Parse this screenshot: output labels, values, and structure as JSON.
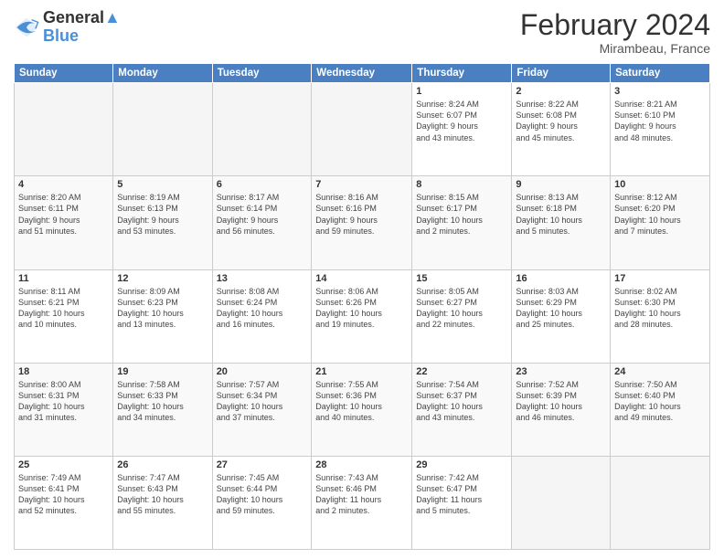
{
  "header": {
    "logo_line1": "General",
    "logo_line2": "Blue",
    "title": "February 2024",
    "subtitle": "Mirambeau, France"
  },
  "days_of_week": [
    "Sunday",
    "Monday",
    "Tuesday",
    "Wednesday",
    "Thursday",
    "Friday",
    "Saturday"
  ],
  "weeks": [
    [
      {
        "num": "",
        "info": "",
        "empty": true
      },
      {
        "num": "",
        "info": "",
        "empty": true
      },
      {
        "num": "",
        "info": "",
        "empty": true
      },
      {
        "num": "",
        "info": "",
        "empty": true
      },
      {
        "num": "1",
        "info": "Sunrise: 8:24 AM\nSunset: 6:07 PM\nDaylight: 9 hours\nand 43 minutes."
      },
      {
        "num": "2",
        "info": "Sunrise: 8:22 AM\nSunset: 6:08 PM\nDaylight: 9 hours\nand 45 minutes."
      },
      {
        "num": "3",
        "info": "Sunrise: 8:21 AM\nSunset: 6:10 PM\nDaylight: 9 hours\nand 48 minutes."
      }
    ],
    [
      {
        "num": "4",
        "info": "Sunrise: 8:20 AM\nSunset: 6:11 PM\nDaylight: 9 hours\nand 51 minutes."
      },
      {
        "num": "5",
        "info": "Sunrise: 8:19 AM\nSunset: 6:13 PM\nDaylight: 9 hours\nand 53 minutes."
      },
      {
        "num": "6",
        "info": "Sunrise: 8:17 AM\nSunset: 6:14 PM\nDaylight: 9 hours\nand 56 minutes."
      },
      {
        "num": "7",
        "info": "Sunrise: 8:16 AM\nSunset: 6:16 PM\nDaylight: 9 hours\nand 59 minutes."
      },
      {
        "num": "8",
        "info": "Sunrise: 8:15 AM\nSunset: 6:17 PM\nDaylight: 10 hours\nand 2 minutes."
      },
      {
        "num": "9",
        "info": "Sunrise: 8:13 AM\nSunset: 6:18 PM\nDaylight: 10 hours\nand 5 minutes."
      },
      {
        "num": "10",
        "info": "Sunrise: 8:12 AM\nSunset: 6:20 PM\nDaylight: 10 hours\nand 7 minutes."
      }
    ],
    [
      {
        "num": "11",
        "info": "Sunrise: 8:11 AM\nSunset: 6:21 PM\nDaylight: 10 hours\nand 10 minutes."
      },
      {
        "num": "12",
        "info": "Sunrise: 8:09 AM\nSunset: 6:23 PM\nDaylight: 10 hours\nand 13 minutes."
      },
      {
        "num": "13",
        "info": "Sunrise: 8:08 AM\nSunset: 6:24 PM\nDaylight: 10 hours\nand 16 minutes."
      },
      {
        "num": "14",
        "info": "Sunrise: 8:06 AM\nSunset: 6:26 PM\nDaylight: 10 hours\nand 19 minutes."
      },
      {
        "num": "15",
        "info": "Sunrise: 8:05 AM\nSunset: 6:27 PM\nDaylight: 10 hours\nand 22 minutes."
      },
      {
        "num": "16",
        "info": "Sunrise: 8:03 AM\nSunset: 6:29 PM\nDaylight: 10 hours\nand 25 minutes."
      },
      {
        "num": "17",
        "info": "Sunrise: 8:02 AM\nSunset: 6:30 PM\nDaylight: 10 hours\nand 28 minutes."
      }
    ],
    [
      {
        "num": "18",
        "info": "Sunrise: 8:00 AM\nSunset: 6:31 PM\nDaylight: 10 hours\nand 31 minutes."
      },
      {
        "num": "19",
        "info": "Sunrise: 7:58 AM\nSunset: 6:33 PM\nDaylight: 10 hours\nand 34 minutes."
      },
      {
        "num": "20",
        "info": "Sunrise: 7:57 AM\nSunset: 6:34 PM\nDaylight: 10 hours\nand 37 minutes."
      },
      {
        "num": "21",
        "info": "Sunrise: 7:55 AM\nSunset: 6:36 PM\nDaylight: 10 hours\nand 40 minutes."
      },
      {
        "num": "22",
        "info": "Sunrise: 7:54 AM\nSunset: 6:37 PM\nDaylight: 10 hours\nand 43 minutes."
      },
      {
        "num": "23",
        "info": "Sunrise: 7:52 AM\nSunset: 6:39 PM\nDaylight: 10 hours\nand 46 minutes."
      },
      {
        "num": "24",
        "info": "Sunrise: 7:50 AM\nSunset: 6:40 PM\nDaylight: 10 hours\nand 49 minutes."
      }
    ],
    [
      {
        "num": "25",
        "info": "Sunrise: 7:49 AM\nSunset: 6:41 PM\nDaylight: 10 hours\nand 52 minutes."
      },
      {
        "num": "26",
        "info": "Sunrise: 7:47 AM\nSunset: 6:43 PM\nDaylight: 10 hours\nand 55 minutes."
      },
      {
        "num": "27",
        "info": "Sunrise: 7:45 AM\nSunset: 6:44 PM\nDaylight: 10 hours\nand 59 minutes."
      },
      {
        "num": "28",
        "info": "Sunrise: 7:43 AM\nSunset: 6:46 PM\nDaylight: 11 hours\nand 2 minutes."
      },
      {
        "num": "29",
        "info": "Sunrise: 7:42 AM\nSunset: 6:47 PM\nDaylight: 11 hours\nand 5 minutes."
      },
      {
        "num": "",
        "info": "",
        "empty": true
      },
      {
        "num": "",
        "info": "",
        "empty": true
      }
    ]
  ]
}
